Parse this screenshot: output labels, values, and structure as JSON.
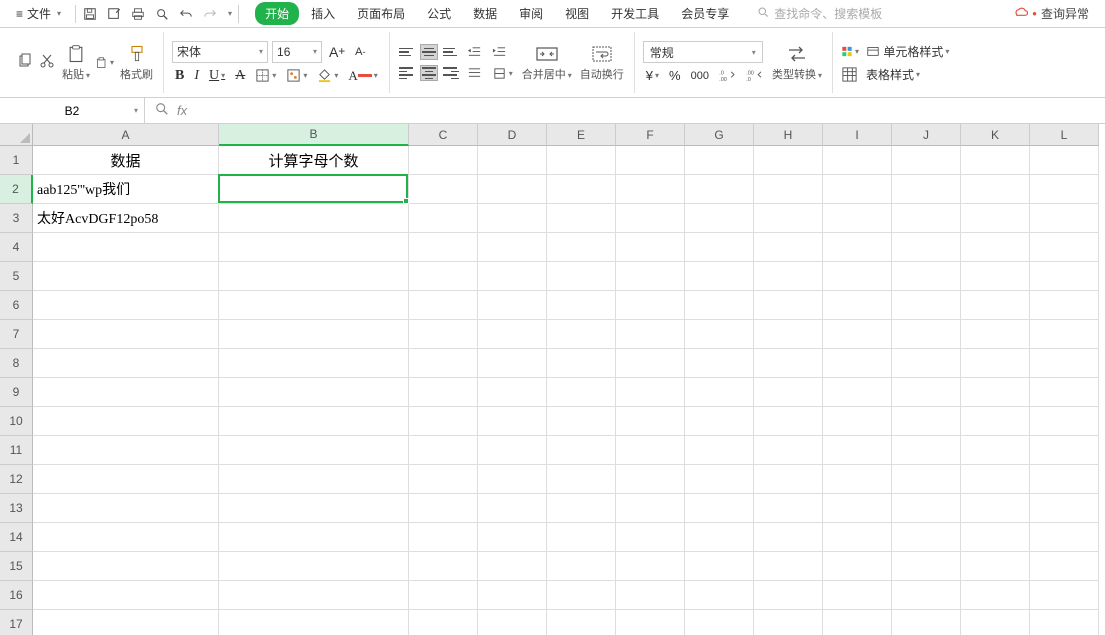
{
  "menubar": {
    "file_label": "文件",
    "tabs": [
      "开始",
      "插入",
      "页面布局",
      "公式",
      "数据",
      "审阅",
      "视图",
      "开发工具",
      "会员专享"
    ],
    "active_tab_index": 0,
    "search_placeholder": "查找命令、搜索模板",
    "alert_label": "查询异常"
  },
  "ribbon": {
    "paste_label": "粘贴",
    "format_painter_label": "格式刷",
    "font_name": "宋体",
    "font_size": "16",
    "merge_label": "合并居中",
    "wrap_label": "自动换行",
    "number_format": "常规",
    "type_convert_label": "类型转换",
    "cell_style_label": "单元格样式",
    "table_style_label": "表格样式"
  },
  "formula_bar": {
    "name_box_value": "B2",
    "fx_label": "fx",
    "formula_value": ""
  },
  "grid": {
    "col_a_width": 186,
    "col_b_width": 190,
    "default_col_width": 69,
    "header_row_height": 29,
    "data_row_height": 29,
    "columns": [
      "A",
      "B",
      "C",
      "D",
      "E",
      "F",
      "G",
      "H",
      "I",
      "J",
      "K",
      "L"
    ],
    "active_col_index": 1,
    "row_count": 17,
    "active_row_index": 1,
    "data": {
      "A1": "数据",
      "B1": "计算字母个数",
      "A2": "aab125'''wp我们",
      "A3": "太好AcvDGF12po58"
    },
    "active_cell": "B2"
  }
}
